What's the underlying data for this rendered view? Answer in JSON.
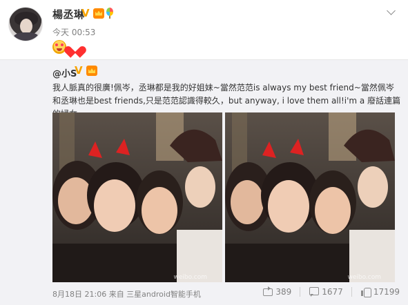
{
  "post": {
    "author": "楊丞琳",
    "timestamp": "今天 00:53"
  },
  "repost": {
    "author": "@小S",
    "text": "我人脈真的很廣!佩岑，丞琳都是我的好姐妹~當然范范is always my best friend~當然佩岑和丞琳也是best friends,只是范范認識得較久，but anyway, i love them all!i'm a  廢話連篇的婦女~",
    "photos": [
      {
        "watermark": "weibo.com"
      },
      {
        "watermark": "weibo.com"
      }
    ],
    "footer": {
      "date_source": "8月18日 21:06 来自 三星android智能手机",
      "repost_count": "389",
      "comment_count": "1677",
      "like_count": "17199"
    }
  },
  "icons": {
    "verified": "verified-v-icon",
    "vip": "vip-crown-icon",
    "balloon": "balloon-icon",
    "emoji_face": "blush-face-icon",
    "emoji_heart": "heart-icon",
    "menu": "chevron-down-icon",
    "repost": "repost-icon",
    "comment": "comment-icon",
    "like": "like-icon"
  },
  "colors": {
    "username": "#333333",
    "meta": "#808080",
    "repost_bg": "#f2f2f5",
    "verified": "#f7a400"
  }
}
